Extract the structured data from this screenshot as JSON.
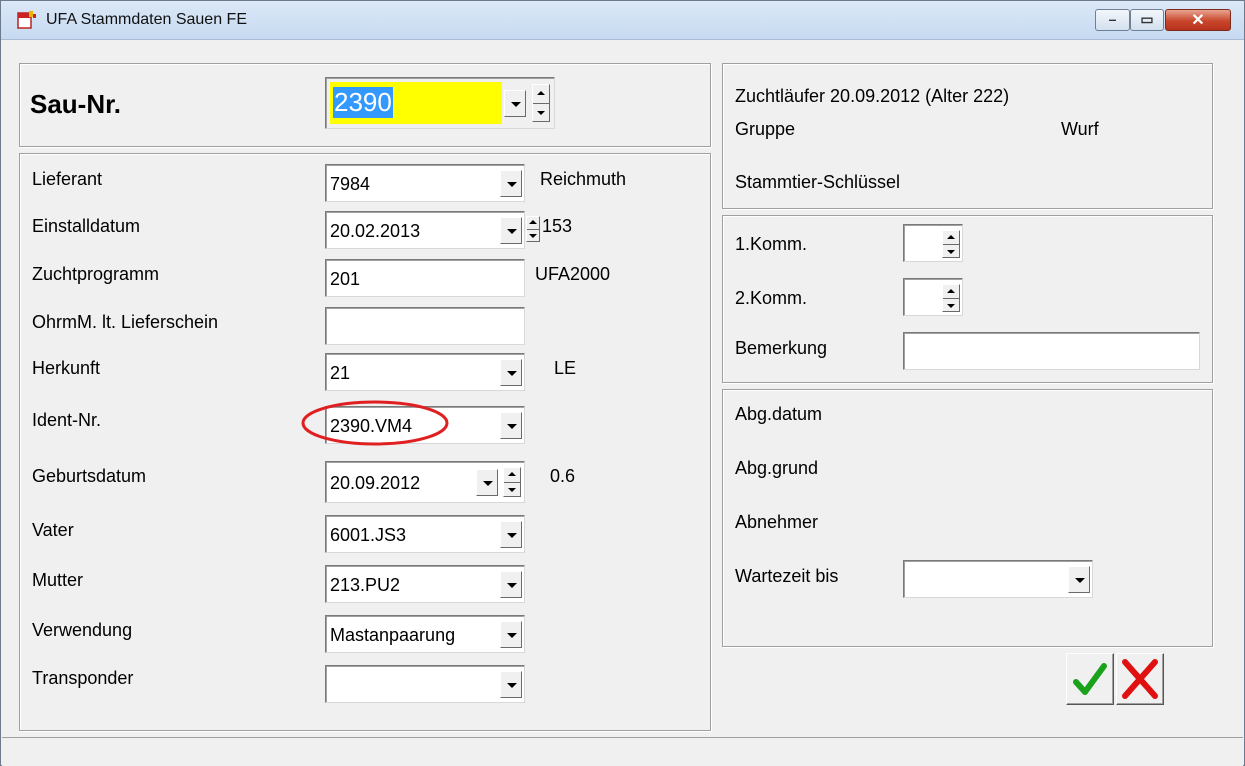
{
  "window": {
    "title": "UFA Stammdaten Sauen FE",
    "close_glyph": "✕",
    "maximize_glyph": "▭",
    "minimize_glyph": "–"
  },
  "sau": {
    "label": "Sau-Nr.",
    "value": "2390"
  },
  "fields": {
    "lieferant": {
      "label": "Lieferant",
      "value": "7984",
      "extra": "Reichmuth"
    },
    "einstalldatum": {
      "label": "Einstalldatum",
      "value": "20.02.2013",
      "extra": "153"
    },
    "zuchtprogramm": {
      "label": "Zuchtprogramm",
      "value": "201",
      "extra": "UFA2000"
    },
    "ohrmarke": {
      "label": "OhrmM. lt. Lieferschein",
      "value": ""
    },
    "herkunft": {
      "label": "Herkunft",
      "value": "21",
      "extra": "LE"
    },
    "ident": {
      "label": "Ident-Nr.",
      "value": "2390.VM4"
    },
    "geburtsdatum": {
      "label": "Geburtsdatum",
      "value": "20.09.2012",
      "extra": "0.6"
    },
    "vater": {
      "label": "Vater",
      "value": "6001.JS3"
    },
    "mutter": {
      "label": "Mutter",
      "value": "213.PU2"
    },
    "verwendung": {
      "label": "Verwendung",
      "value": "Mastanpaarung"
    },
    "transponder": {
      "label": "Transponder",
      "value": ""
    }
  },
  "info": {
    "zuchtlaeufer": "Zuchtläufer 20.09.2012 (Alter 222)",
    "gruppe": "Gruppe",
    "wurf": "Wurf",
    "stammtier": "Stammtier-Schlüssel"
  },
  "komm": {
    "komm1": {
      "label": "1.Komm.",
      "value": ""
    },
    "komm2": {
      "label": "2.Komm.",
      "value": ""
    },
    "bemerkung": {
      "label": "Bemerkung",
      "value": ""
    }
  },
  "abgang": {
    "abg_datum": "Abg.datum",
    "abg_grund": "Abg.grund",
    "abnehmer": "Abnehmer",
    "wartezeit": {
      "label": "Wartezeit bis",
      "value": ""
    }
  },
  "colors": {
    "highlight_field": "#ffff00",
    "selection": "#3399ff",
    "annotation_circle": "#e02020",
    "ok_green": "#1aa31a",
    "cancel_red": "#e01010"
  },
  "icons": {
    "ok": "checkmark-icon",
    "cancel": "x-icon"
  }
}
